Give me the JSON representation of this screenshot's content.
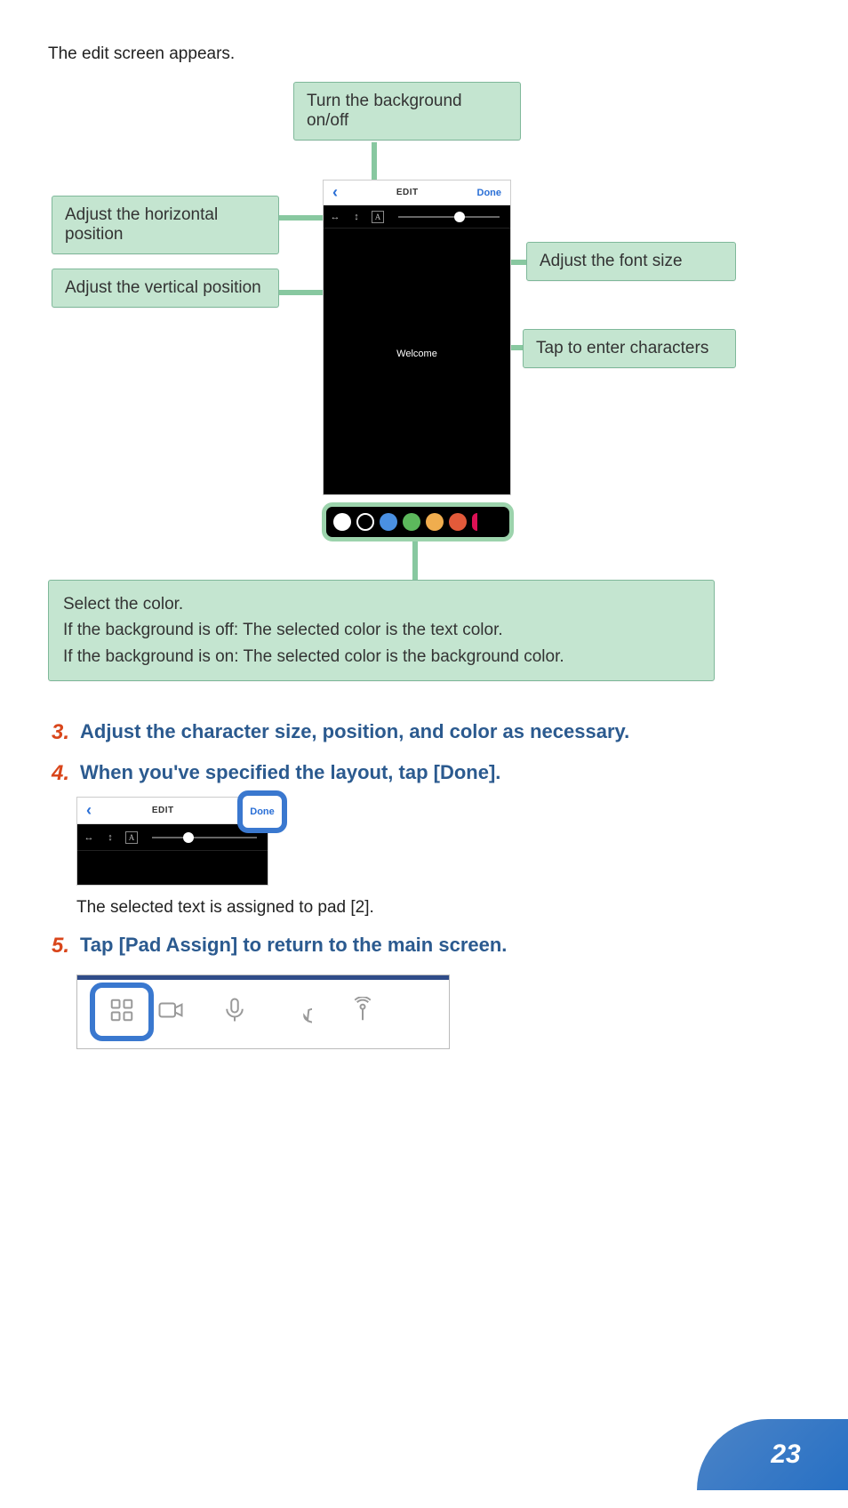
{
  "intro": "The edit screen appears.",
  "callouts": {
    "bg_toggle": "Turn the background on/off",
    "h_position": "Adjust the horizontal position",
    "v_position": "Adjust the vertical position",
    "font_size": "Adjust the font size",
    "enter_chars": "Tap to enter characters",
    "color_title": "Select the color.",
    "color_line1": "If the background is off: The selected color is the text color.",
    "color_line2": "If the background is on: The selected color is the background color."
  },
  "phone": {
    "back": "‹",
    "title": "EDIT",
    "done": "Done",
    "welcome": "Welcome"
  },
  "steps": {
    "s3_num": "3.",
    "s3": "Adjust the character size, position, and color as necessary.",
    "s4_num": "4.",
    "s4": "When you've specified the layout, tap [Done].",
    "s4_sub": "The selected text is assigned to pad [2].",
    "s5_num": "5.",
    "s5": "Tap [Pad Assign] to return to the main screen."
  },
  "page_number": "23"
}
